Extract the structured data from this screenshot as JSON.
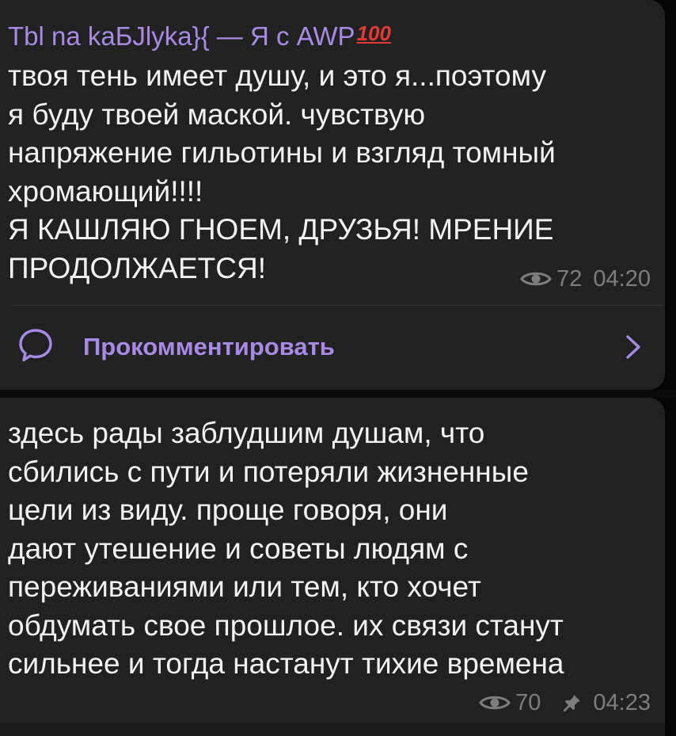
{
  "messages": [
    {
      "author": "Tbl na kaБJlyka}{ — Я с AWP",
      "author_emoji": "100",
      "lines": [
        "твоя тень имеет душу, и это я...поэтому",
        "я буду твоей маской. чувствую",
        "напряжение гильотины и взгляд томный",
        "хромающий!!!!",
        "Я КАШЛЯЮ ГНОЕМ, ДРУЗЬЯ! МРЕНИЕ",
        "ПРОДОЛЖАЕТСЯ!"
      ],
      "views": "72",
      "time": "04:20",
      "comment_label": "Прокомментировать"
    },
    {
      "lines": [
        "здесь рады заблудшим душам, что",
        "сбились с пути и потеряли жизненные",
        "цели из виду. проще говоря, они",
        "дают утешение и советы людям с",
        "переживаниями или тем, кто хочет",
        "обдумать свое прошлое. их связи станут",
        "сильнее и тогда настанут тихие времена"
      ],
      "views": "70",
      "time": "04:23"
    }
  ],
  "icons": {
    "views": "eye-icon",
    "pinned": "pin-icon",
    "comment": "comment-bubble-icon",
    "open": "chevron-right-icon"
  },
  "colors": {
    "background": "#050505",
    "bubble": "#212121",
    "accent": "#a88ae6",
    "text": "#f2f2f2",
    "meta": "#7d7d7d"
  }
}
